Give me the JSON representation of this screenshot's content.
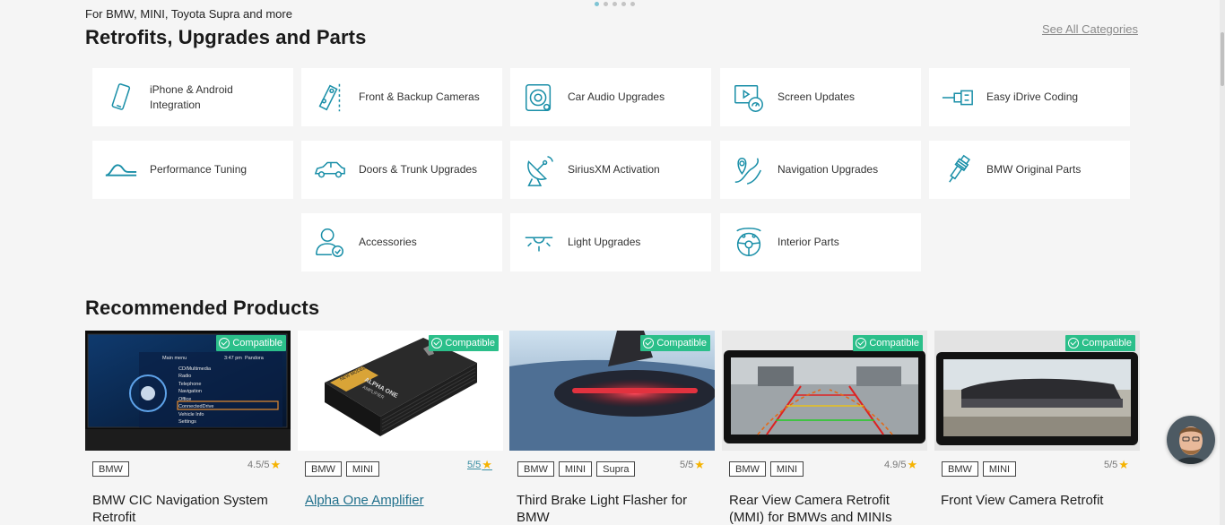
{
  "hero": {
    "kicker": "For BMW, MINI, Toyota Supra and more"
  },
  "categories_section": {
    "title": "Retrofits, Upgrades and Parts",
    "see_all": "See All Categories",
    "items": [
      {
        "label": "iPhone & Android Integration",
        "icon": "phone-icon"
      },
      {
        "label": "Front & Backup Cameras",
        "icon": "car-camera-icon"
      },
      {
        "label": "Car Audio Upgrades",
        "icon": "speaker-icon"
      },
      {
        "label": "Screen Updates",
        "icon": "screen-gauge-icon"
      },
      {
        "label": "Easy iDrive Coding",
        "icon": "usb-icon"
      },
      {
        "label": "Performance Tuning",
        "icon": "tuning-curve-icon"
      },
      {
        "label": "Doors & Trunk Upgrades",
        "icon": "car-door-icon"
      },
      {
        "label": "SiriusXM Activation",
        "icon": "satellite-dish-icon"
      },
      {
        "label": "Navigation Upgrades",
        "icon": "map-pin-icon"
      },
      {
        "label": "BMW Original Parts",
        "icon": "spark-plug-icon"
      },
      {
        "label": "Accessories",
        "icon": "user-check-icon"
      },
      {
        "label": "Light Upgrades",
        "icon": "light-icon"
      },
      {
        "label": "Interior Parts",
        "icon": "steering-wheel-icon"
      }
    ]
  },
  "products_section": {
    "title": "Recommended Products",
    "badge": "Compatible",
    "items": [
      {
        "name": "BMW CIC Navigation System Retrofit",
        "tags": [
          "BMW"
        ],
        "rating": "4.5/5"
      },
      {
        "name": "Alpha One Amplifier",
        "tags": [
          "BMW",
          "MINI"
        ],
        "rating": "5/5"
      },
      {
        "name": "Third Brake Light Flasher for BMW",
        "tags": [
          "BMW",
          "MINI",
          "Supra"
        ],
        "rating": "5/5"
      },
      {
        "name": "Rear View Camera Retrofit (MMI) for BMWs and MINIs",
        "tags": [
          "BMW",
          "MINI"
        ],
        "rating": "4.9/5"
      },
      {
        "name": "Front View Camera Retrofit",
        "tags": [
          "BMW",
          "MINI"
        ],
        "rating": "5/5"
      }
    ],
    "nav_screen": {
      "header_left": "Main menu",
      "header_right": "3:47 pm",
      "header_station": "Pandora",
      "menu": [
        "CD/Multimedia",
        "Radio",
        "Telephone",
        "Navigation",
        "Office",
        "ConnectedDrive",
        "Vehicle Info",
        "Settings"
      ]
    },
    "amp_box": {
      "sticker": "NEW MODEL",
      "brand": "ALPHA ONE",
      "line": "AMPLIFIER"
    }
  },
  "colors": {
    "accent": "#1a8fa8",
    "badge": "#2bbf8a",
    "star": "#f5b301"
  }
}
